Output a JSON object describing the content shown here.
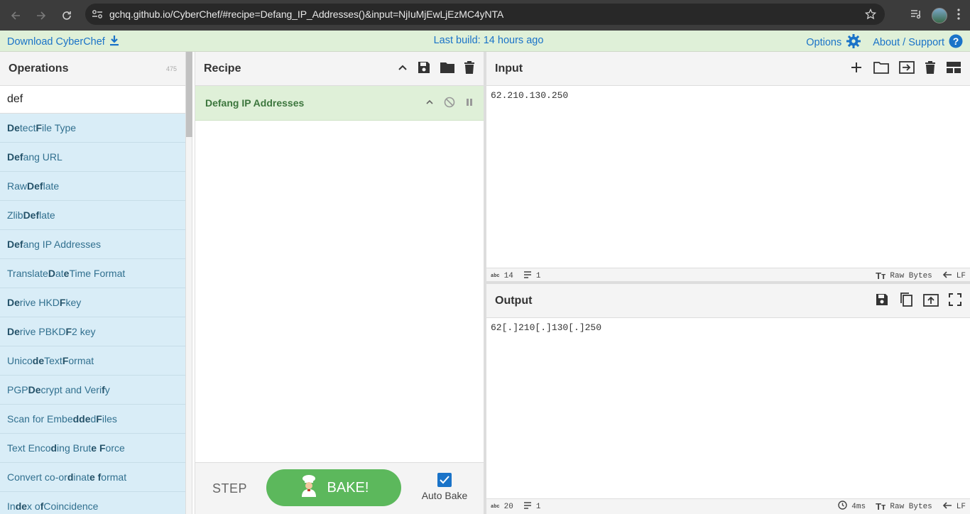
{
  "browser": {
    "url": "gchq.github.io/CyberChef/#recipe=Defang_IP_Addresses()&input=NjIuMjEwLjEzMC4yNTA"
  },
  "banner": {
    "download_label": "Download CyberChef",
    "build_label": "Last build: 14 hours ago",
    "options_label": "Options",
    "about_label": "About / Support"
  },
  "operations": {
    "title": "Operations",
    "count": "475",
    "search_value": "def",
    "items": [
      {
        "pre": "",
        "b1": "De",
        "mid": "tect ",
        "b2": "F",
        "post": "ile Type"
      },
      {
        "pre": "",
        "b1": "Def",
        "mid": "ang URL",
        "b2": "",
        "post": ""
      },
      {
        "pre": "Raw ",
        "b1": "Def",
        "mid": "late",
        "b2": "",
        "post": ""
      },
      {
        "pre": "Zlib ",
        "b1": "Def",
        "mid": "late",
        "b2": "",
        "post": ""
      },
      {
        "pre": "",
        "b1": "Def",
        "mid": "ang IP Addresses",
        "b2": "",
        "post": ""
      },
      {
        "pre": "Translate ",
        "b1": "D",
        "mid": "at",
        "b2": "e",
        "post": "Time Format"
      },
      {
        "pre": "",
        "b1": "De",
        "mid": "rive HKD",
        "b2": "F",
        "post": " key"
      },
      {
        "pre": "",
        "b1": "De",
        "mid": "rive PBKD",
        "b2": "F",
        "post": "2 key"
      },
      {
        "pre": "Unico",
        "b1": "de",
        "mid": " Text ",
        "b2": "F",
        "post": "ormat"
      },
      {
        "pre": "PGP ",
        "b1": "De",
        "mid": "crypt and Veri",
        "b2": "f",
        "post": "y"
      },
      {
        "pre": "Scan for Embe",
        "b1": "dde",
        "mid": "d ",
        "b2": "F",
        "post": "iles"
      },
      {
        "pre": "Text Enco",
        "b1": "d",
        "mid": "ing Brut",
        "b2": "e F",
        "post": "orce"
      },
      {
        "pre": "Convert co-or",
        "b1": "d",
        "mid": "inat",
        "b2": "e f",
        "post": "ormat"
      },
      {
        "pre": "In",
        "b1": "de",
        "mid": "x o",
        "b2": "f",
        "post": " Coincidence"
      }
    ]
  },
  "recipe": {
    "title": "Recipe",
    "items": [
      {
        "name": "Defang IP Addresses"
      }
    ],
    "step_label": "STEP",
    "bake_label": "BAKE!",
    "autobake_label": "Auto Bake"
  },
  "input": {
    "title": "Input",
    "value": "62.210.130.250",
    "length": "14",
    "lines": "1",
    "encoding": "Raw Bytes",
    "eol": "LF"
  },
  "output": {
    "title": "Output",
    "value": "62[.]210[.]130[.]250",
    "length": "20",
    "lines": "1",
    "time": "4ms",
    "encoding": "Raw Bytes",
    "eol": "LF"
  }
}
